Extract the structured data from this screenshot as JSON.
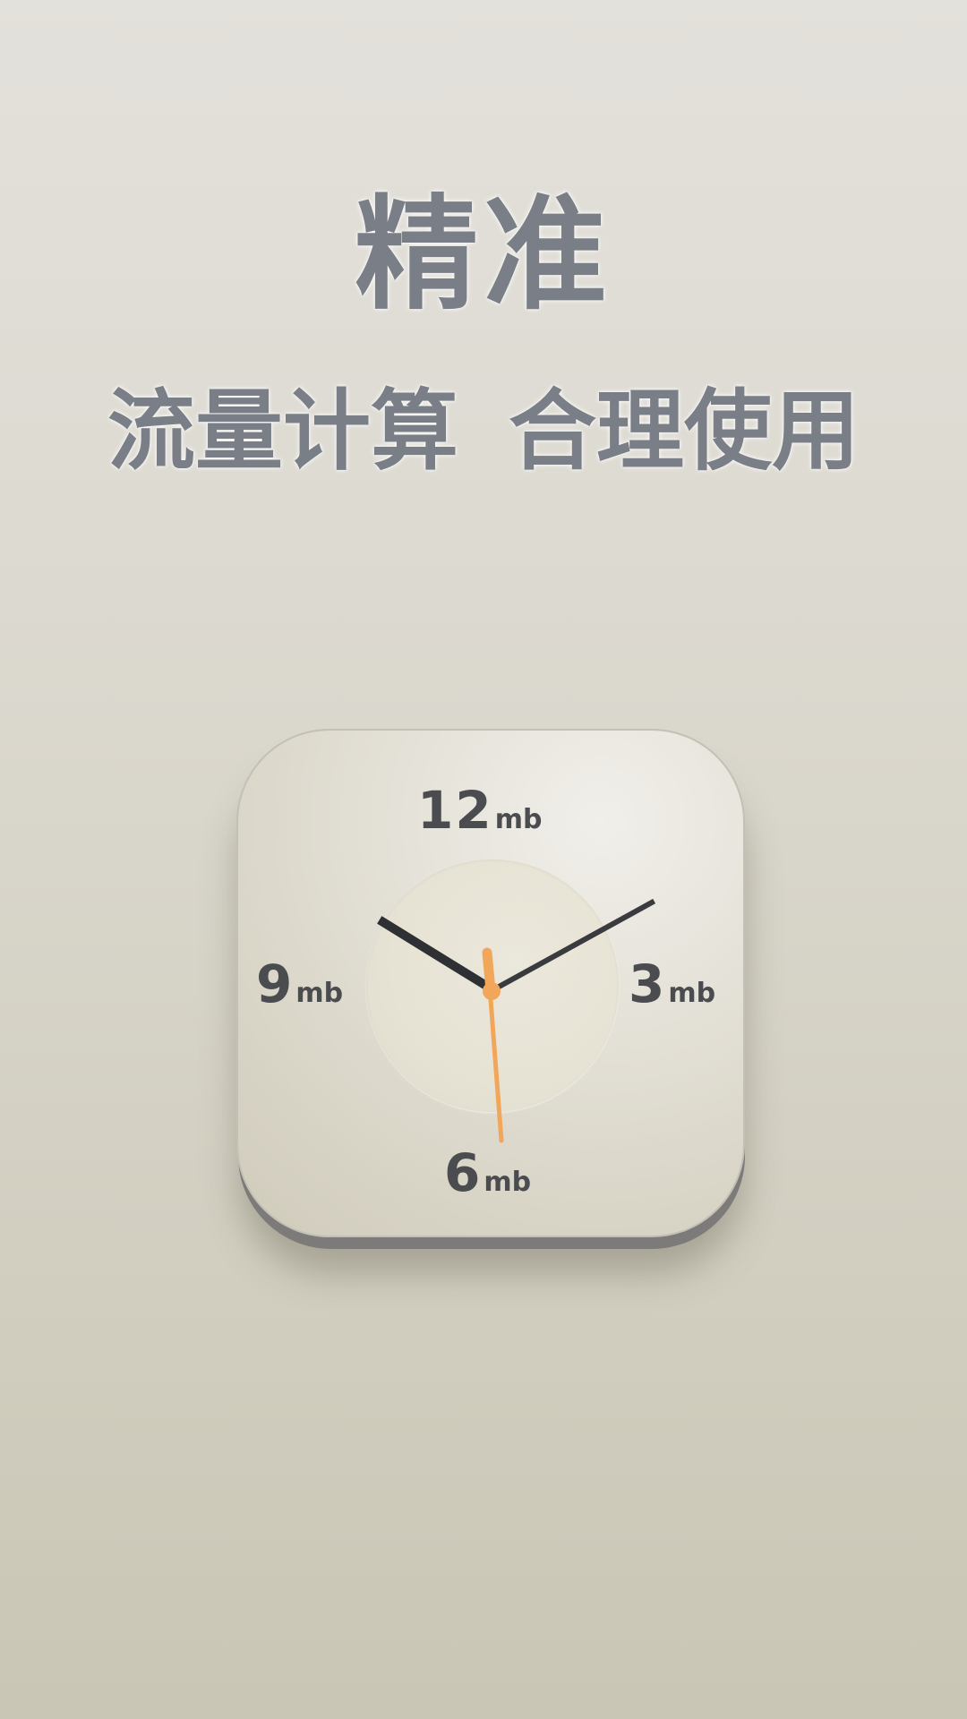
{
  "headline": {
    "title": "精准",
    "subtitle_part1": "流量计算",
    "subtitle_part2": "合理使用"
  },
  "clock": {
    "marks": [
      {
        "value": "12",
        "unit": "mb"
      },
      {
        "value": "3",
        "unit": "mb"
      },
      {
        "value": "6",
        "unit": "mb"
      },
      {
        "value": "9",
        "unit": "mb"
      }
    ],
    "hand_colors": {
      "hour": "#2f3033",
      "minute": "#3a3b3e",
      "second": "#f2a65a"
    }
  },
  "colors": {
    "headline": "#7a7e86",
    "background_top": "#e3e1db",
    "background_bottom": "#cac6b5"
  }
}
